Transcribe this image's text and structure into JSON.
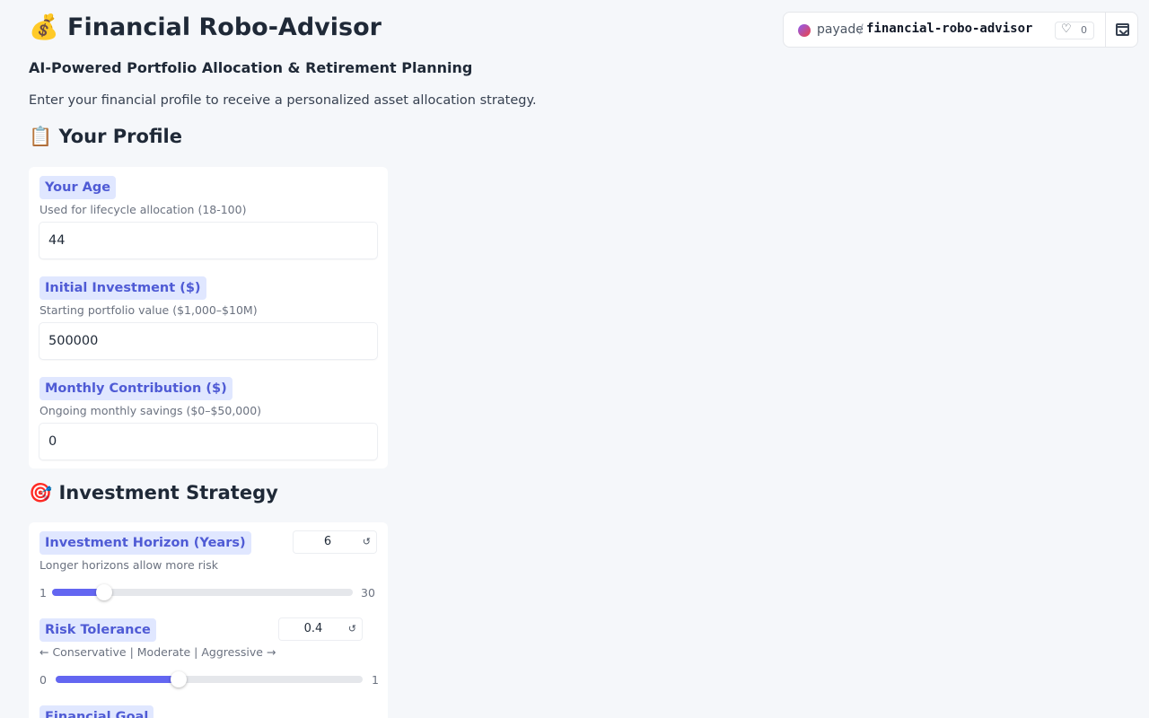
{
  "header": {
    "title": "💰 Financial Robo-Advisor",
    "subtitle": "AI-Powered Portfolio Allocation & Retirement Planning",
    "intro": "Enter your financial profile to receive a personalized asset allocation strategy."
  },
  "badge": {
    "owner": "payade",
    "slash": "/",
    "repo": "financial-robo-advisor",
    "likes": "0"
  },
  "profile": {
    "heading": "📋 Your Profile",
    "age": {
      "label": "Your Age",
      "help": "Used for lifecycle allocation (18-100)",
      "value": "44"
    },
    "investment": {
      "label": "Initial Investment ($)",
      "help": "Starting portfolio value ($1,000–$10M)",
      "value": "500000"
    },
    "contribution": {
      "label": "Monthly Contribution ($)",
      "help": "Ongoing monthly savings ($0–$50,000)",
      "value": "0"
    }
  },
  "strategy": {
    "heading": "🎯 Investment Strategy",
    "horizon": {
      "label": "Investment Horizon (Years)",
      "help": "Longer horizons allow more risk",
      "value": "6",
      "min": "1",
      "max": "30",
      "fraction": 0.1724
    },
    "risk": {
      "label": "Risk Tolerance",
      "help": "← Conservative | Moderate | Aggressive →",
      "value": "0.4",
      "min": "0",
      "max": "1",
      "fraction": 0.4
    },
    "goal": {
      "label": "Financial Goal"
    }
  },
  "icons": {
    "reset": "reset-icon",
    "heart": "heart-icon",
    "collapse": "collapse-icon"
  },
  "colors": {
    "accent": "#6366f1",
    "label_bg": "#e0e7ff",
    "label_text": "#4f5bd5"
  }
}
